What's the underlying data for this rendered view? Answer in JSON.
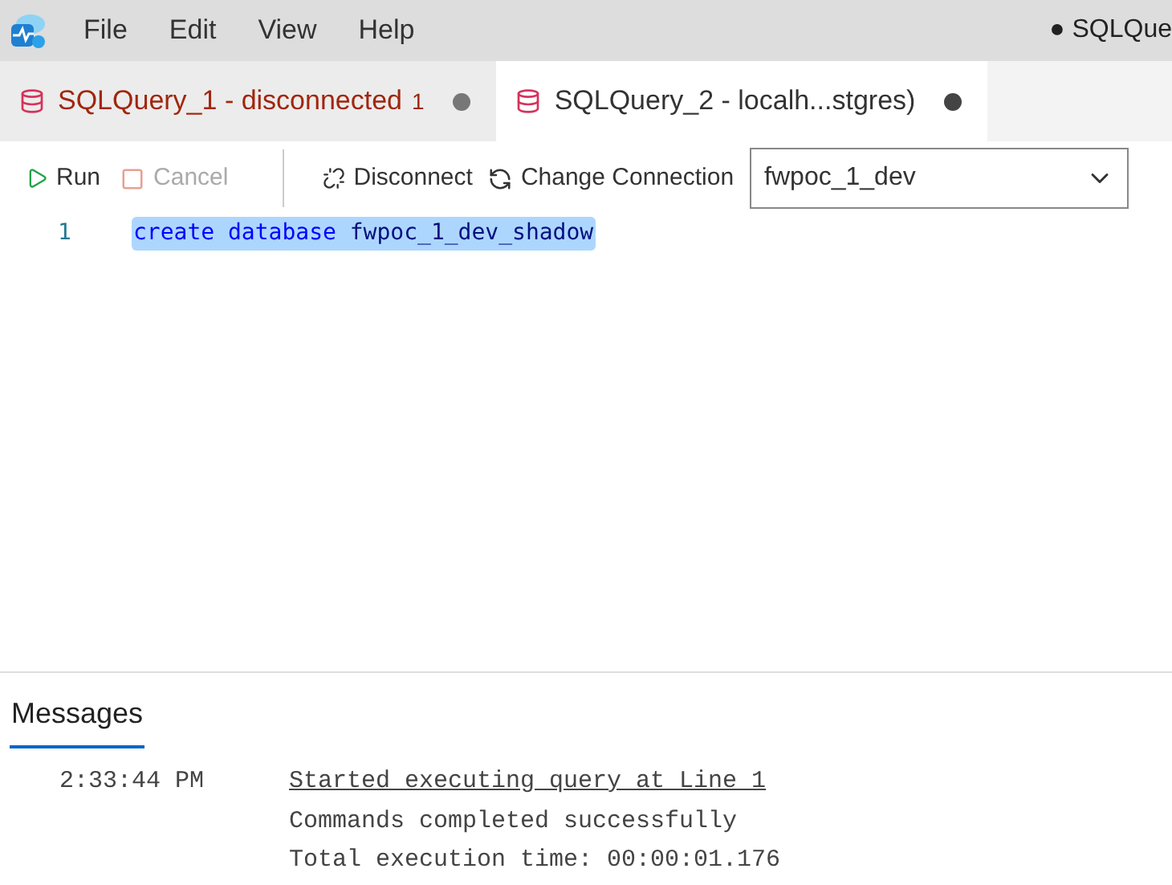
{
  "menu": [
    "File",
    "Edit",
    "View",
    "Help"
  ],
  "window": {
    "title": "● SQLQue"
  },
  "tabs": [
    {
      "label": "SQLQuery_1 - disconnected",
      "error_count": "1",
      "error": true,
      "selected": false,
      "dirty": true
    },
    {
      "label": "SQLQuery_2 - localh...stgres)",
      "error": false,
      "selected": true,
      "dirty": true
    }
  ],
  "toolbar": {
    "run": {
      "label": "Run",
      "disabled": false
    },
    "cancel": {
      "label": "Cancel",
      "disabled": true
    },
    "disconnect": "Disconnect",
    "change_connection": "Change Connection",
    "database": "fwpoc_1_dev"
  },
  "editor": {
    "lines": [
      {
        "number": "1",
        "tokens": [
          {
            "text": "create",
            "kind": "keyword"
          },
          {
            "text": "database",
            "kind": "keyword"
          },
          {
            "text": "fwpoc_1_dev_shadow",
            "kind": "identifier"
          }
        ]
      }
    ]
  },
  "messages": {
    "tab": "Messages",
    "time": "2:33:44 PM",
    "lines": [
      {
        "text": "Started executing query at Line 1",
        "kind": "link"
      },
      {
        "text": "Commands completed successfully",
        "kind": "plain"
      },
      {
        "text": "Total execution time: 00:00:01.176",
        "kind": "plain"
      }
    ]
  }
}
